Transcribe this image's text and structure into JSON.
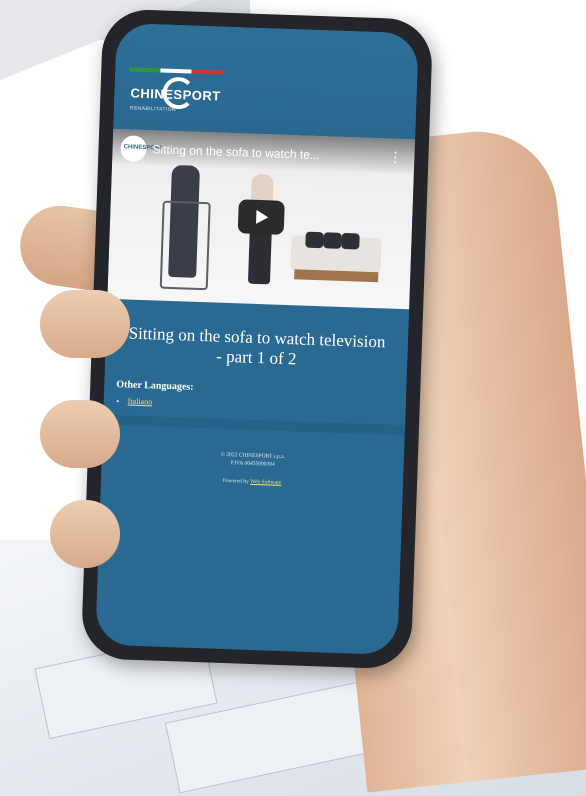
{
  "video": {
    "channel_badge": "CHINESPORT",
    "title": "Sitting on the sofa to watch te..."
  },
  "header": {
    "logo_text": "CHINESPORT",
    "tagline": "REHABILITATION"
  },
  "page": {
    "title": "Sitting on the sofa to watch television - part 1 of 2",
    "other_languages_label": "Other Languages:",
    "languages": [
      "Italiano"
    ]
  },
  "footer": {
    "copyright": "© 2022 CHINESPORT s.p.a.",
    "vat": "P.IVA 00455090304",
    "powered_by_label": "Powered by",
    "powered_by_link": "Web Software"
  }
}
